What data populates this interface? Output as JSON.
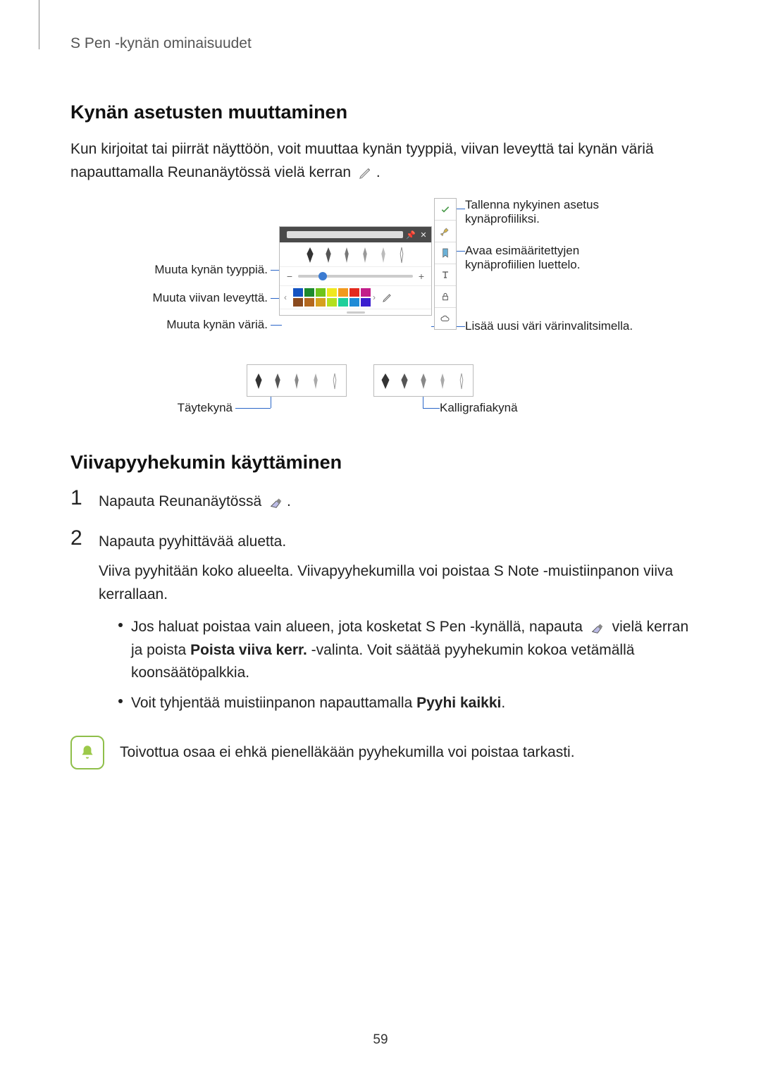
{
  "header": "S Pen -kynän ominaisuudet",
  "section1": {
    "title": "Kynän asetusten muuttaminen",
    "intro_a": "Kun kirjoitat tai piirrät näyttöön, voit muuttaa kynän tyyppiä, viivan leveyttä tai kynän väriä napauttamalla Reunanäytössä vielä kerran ",
    "intro_b": "."
  },
  "callouts": {
    "left": {
      "type": "Muuta kynän tyyppiä.",
      "width": "Muuta viivan leveyttä.",
      "color": "Muuta kynän väriä.",
      "fountain": "Täytekynä"
    },
    "right": {
      "save": "Tallenna nykyinen asetus kynäprofiiliksi.",
      "open": "Avaa esimääritettyjen kynäprofiilien luettelo.",
      "picker": "Lisää uusi väri värinvalitsimella.",
      "calligraphy": "Kalligrafiakynä"
    }
  },
  "section2": {
    "title": "Viivapyyhekumin käyttäminen",
    "step1_a": "Napauta Reunanäytössä ",
    "step1_b": ".",
    "step2": "Napauta pyyhittävää aluetta.",
    "step2_detail": "Viiva pyyhitään koko alueelta. Viivapyyhekumilla voi poistaa S Note -muistiinpanon viiva kerrallaan.",
    "bullet1_a": "Jos haluat poistaa vain alueen, jota kosketat S Pen -kynällä, napauta ",
    "bullet1_b": " vielä kerran ja poista ",
    "bullet1_bold": "Poista viiva kerr.",
    "bullet1_c": " -valinta. Voit säätää pyyhekumin kokoa vetämällä koonsäätöpalkkia.",
    "bullet2_a": "Voit tyhjentää muistiinpanon napauttamalla ",
    "bullet2_bold": "Pyyhi kaikki",
    "bullet2_b": ".",
    "note": "Toivottua osaa ei ehkä pienelläkään pyyhekumilla voi poistaa tarkasti."
  },
  "pageNumber": "59",
  "colors_row1": [
    "#1453c2",
    "#1c8a2e",
    "#6fc41c",
    "#f0e81e",
    "#f29a1e",
    "#e42a1e",
    "#c21e8a"
  ],
  "colors_row2": [
    "#8a4a1e",
    "#b3671e",
    "#d6a01e",
    "#b3e01e",
    "#1ecf9a",
    "#1e8ad6",
    "#3a1ecf"
  ]
}
